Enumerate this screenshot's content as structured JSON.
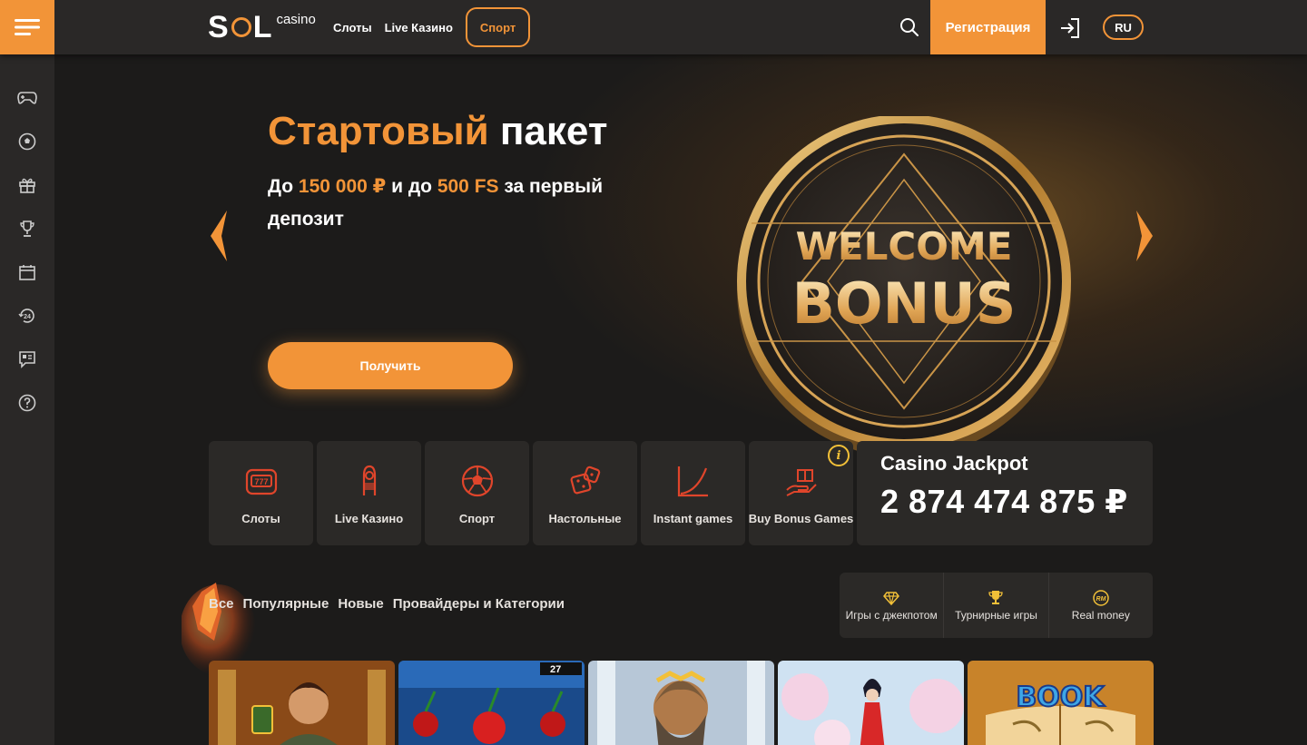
{
  "header": {
    "logo_main": "SOL",
    "logo_sub": "casino",
    "nav": [
      "Слоты",
      "Live Казино",
      "Спорт"
    ],
    "register_label": "Регистрация",
    "lang_label": "RU"
  },
  "sidebar": {
    "items": [
      "gamepad-icon",
      "soccer-ball-icon",
      "gift-icon",
      "trophy-icon",
      "calendar-icon",
      "support-24-icon",
      "chat-icon",
      "help-icon"
    ]
  },
  "hero": {
    "title_accent": "Стартовый",
    "title_rest": "пакет",
    "sub_prefix": "До ",
    "sub_amount": "150 000 ₽",
    "sub_mid": " и до ",
    "sub_fs": "500 FS",
    "sub_suffix": " за первый депозит",
    "cta_label": "Получить",
    "coin_line1": "WELCOME",
    "coin_line2": "BONUS"
  },
  "categories": [
    {
      "label": "Слоты",
      "icon": "slot-machine-icon"
    },
    {
      "label": "Live Казино",
      "icon": "dealer-icon"
    },
    {
      "label": "Спорт",
      "icon": "soccer-ball-icon"
    },
    {
      "label": "Настольные",
      "icon": "dice-icon"
    },
    {
      "label": "Instant games",
      "icon": "chart-curve-icon"
    },
    {
      "label": "Buy Bonus Games",
      "icon": "hand-gift-icon"
    }
  ],
  "jackpot": {
    "title": "Casino Jackpot",
    "value": "2 874 474 875 ₽"
  },
  "filters": [
    "Все",
    "Популярные",
    "Новые",
    "Провайдеры и Категории"
  ],
  "quick_filters": [
    {
      "label": "Игры с джекпотом",
      "icon": "diamond-icon"
    },
    {
      "label": "Турнирные игры",
      "icon": "trophy-icon"
    },
    {
      "label": "Real money",
      "icon": "rm-coin-icon"
    }
  ],
  "games": [
    {
      "icon": "explorer-game-icon"
    },
    {
      "icon": "fruit-game-icon",
      "badge": "27"
    },
    {
      "icon": "zeus-game-icon"
    },
    {
      "icon": "geisha-game-icon"
    },
    {
      "icon": "book-game-icon",
      "badge": "BOOK"
    }
  ],
  "colors": {
    "accent": "#f29438",
    "background": "#1c1b1a",
    "panel": "#2b2927",
    "icon_red": "#e0452b"
  }
}
